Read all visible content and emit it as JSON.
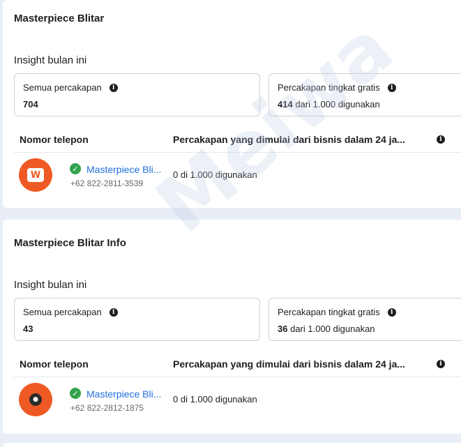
{
  "cards": [
    {
      "title": "Masterpiece Blitar",
      "insight_label": "Insight bulan ini",
      "metrics": {
        "all_conversations_label": "Semua percakapan",
        "all_conversations_value": "704",
        "free_label": "Percakapan tingkat gratis",
        "free_value": "414",
        "free_suffix": "dari 1.000 digunakan"
      },
      "table": {
        "col_phone": "Nomor telepon",
        "col_conv": "Percakapan yang dimulai dari bisnis dalam 24 ja...",
        "rows": [
          {
            "name": "Masterpiece Bli...",
            "phone": "+62 822-2811-3539",
            "usage": "0 di 1.000 digunakan"
          }
        ]
      }
    },
    {
      "title": "Masterpiece Blitar Info",
      "insight_label": "Insight bulan ini",
      "metrics": {
        "all_conversations_label": "Semua percakapan",
        "all_conversations_value": "43",
        "free_label": "Percakapan tingkat gratis",
        "free_value": "36",
        "free_suffix": "dari 1.000 digunakan"
      },
      "table": {
        "col_phone": "Nomor telepon",
        "col_conv": "Percakapan yang dimulai dari bisnis dalam 24 ja...",
        "rows": [
          {
            "name": "Masterpiece Bli...",
            "phone": "+62 822-2812-1875",
            "usage": "0 di 1.000 digunakan"
          }
        ]
      }
    }
  ],
  "icons": {
    "info": "info-icon",
    "verified": "verified-check-icon",
    "avatar": "business-avatar"
  },
  "colors": {
    "link": "#216fdb",
    "verified": "#31a24c",
    "avatar_bg": "#ef5a24",
    "page_bg": "#e9eef6"
  },
  "watermark": "Meiwa"
}
